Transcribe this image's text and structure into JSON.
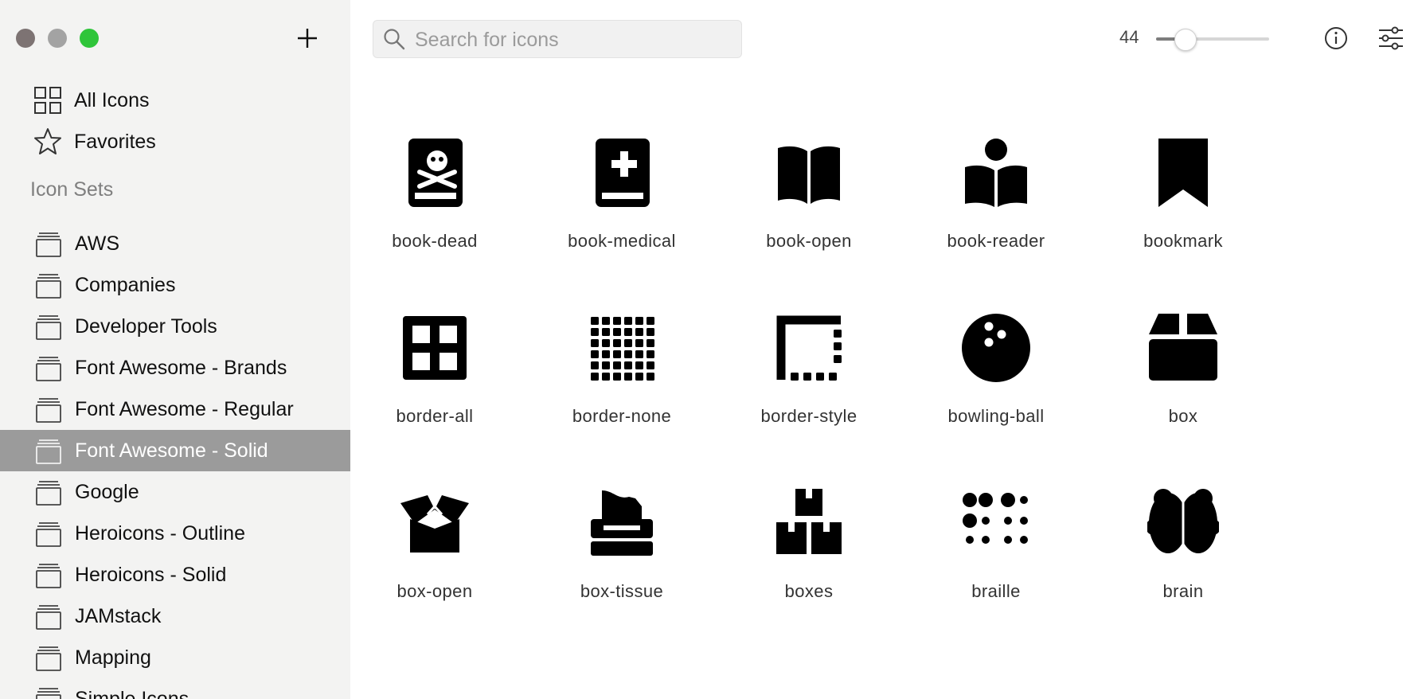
{
  "sidebar": {
    "add_icon": "plus-icon",
    "nav": [
      {
        "label": "All Icons",
        "icon": "grid-icon"
      },
      {
        "label": "Favorites",
        "icon": "star-icon"
      }
    ],
    "section_title": "Icon Sets",
    "sets": [
      {
        "label": "AWS"
      },
      {
        "label": "Companies"
      },
      {
        "label": "Developer Tools"
      },
      {
        "label": "Font Awesome - Brands"
      },
      {
        "label": "Font Awesome - Regular"
      },
      {
        "label": "Font Awesome - Solid",
        "active": true
      },
      {
        "label": "Google"
      },
      {
        "label": "Heroicons - Outline"
      },
      {
        "label": "Heroicons - Solid"
      },
      {
        "label": "JAMstack"
      },
      {
        "label": "Mapping"
      },
      {
        "label": "Simple Icons"
      }
    ]
  },
  "toolbar": {
    "search_placeholder": "Search for icons",
    "icon_size": "44",
    "icon_size_fraction": 0.25
  },
  "icons": [
    {
      "name": "book-dead"
    },
    {
      "name": "book-medical"
    },
    {
      "name": "book-open"
    },
    {
      "name": "book-reader"
    },
    {
      "name": "bookmark"
    },
    {
      "name": "border-all"
    },
    {
      "name": "border-none"
    },
    {
      "name": "border-style"
    },
    {
      "name": "bowling-ball"
    },
    {
      "name": "box"
    },
    {
      "name": "box-open"
    },
    {
      "name": "box-tissue"
    },
    {
      "name": "boxes"
    },
    {
      "name": "braille"
    },
    {
      "name": "brain"
    }
  ],
  "colors": {
    "sidebar_bg": "#f3f3f2",
    "active_item_bg": "#9b9b9b",
    "close": "#7d7373",
    "minimize": "#a3a3a3",
    "zoom": "#2fc53a"
  }
}
